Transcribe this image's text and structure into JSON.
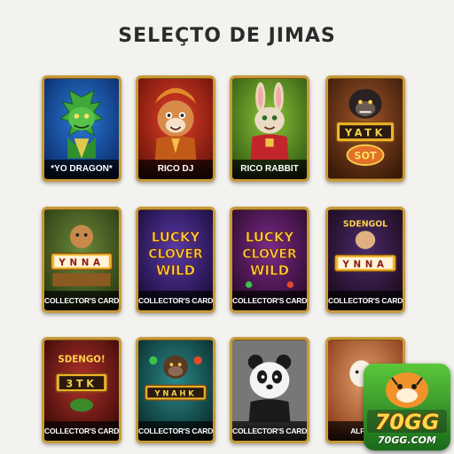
{
  "page": {
    "title": "SELEÇTO DE JIMAS"
  },
  "cards": [
    {
      "label": "*YO DRAGON*"
    },
    {
      "label": "RICO DJ"
    },
    {
      "label": "RICO RABBIT"
    },
    {
      "label": "",
      "reel_text": "YATK",
      "badge_text": "SOT"
    },
    {
      "label": "COLLECTOR'S CARD",
      "reel_text": "YNNA"
    },
    {
      "label": "COLLECTOR'S CARD",
      "art_text": [
        "LUCKY",
        "CLOVER",
        "WILD"
      ]
    },
    {
      "label": "COLLECTOR'S CARD",
      "art_text": [
        "LUCKY",
        "CLOVER",
        "WILD"
      ]
    },
    {
      "label": "COLLECTOR'S CARD",
      "top_text": "SDENGOL",
      "reel_text": "YNNA"
    },
    {
      "label": "COLLECTOR'S CARD",
      "top_text": "SDENGO!",
      "reel_text": "3TK"
    },
    {
      "label": "COLLECTOR'S CARD",
      "reel_text": "YNAHK"
    },
    {
      "label": "COLLECTOR'S CARD"
    },
    {
      "label": "ALPACA"
    }
  ],
  "logo": {
    "main": "70GG",
    "sub": "70GG.COM"
  }
}
